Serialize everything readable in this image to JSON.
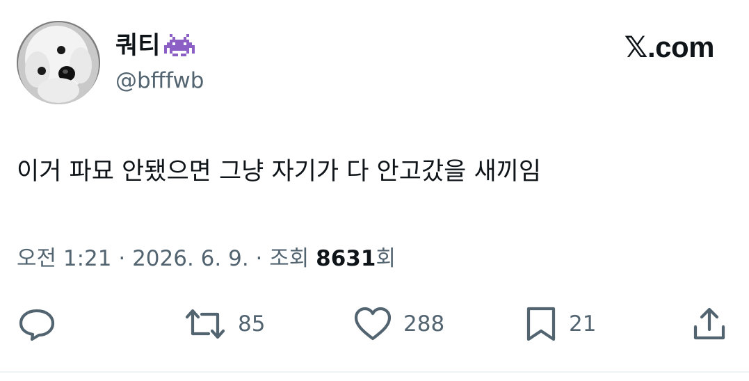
{
  "author": {
    "display_name": "쿼티",
    "emoji_icon": "alien-monster-icon",
    "handle": "@bfffwb"
  },
  "brand": {
    "x_glyph": "𝕏",
    "suffix": ".com"
  },
  "tweet": {
    "text": "이거 파묘 안됐으면 그냥 자기가 다 안고갔을 새끼임"
  },
  "meta": {
    "time": "오전 1:21",
    "sep1": " · ",
    "date": "2026. 6. 9.",
    "sep2": " · ",
    "views_label": "조회 ",
    "views_count": "8631",
    "views_suffix": "회"
  },
  "actions": {
    "reply_icon": "reply-icon",
    "retweet_count": "85",
    "like_count": "288",
    "bookmark_count": "21",
    "share_icon": "share-icon"
  },
  "colors": {
    "text_primary": "#0f1419",
    "text_secondary": "#536471",
    "emoji_purple": "#8b5fc4"
  }
}
